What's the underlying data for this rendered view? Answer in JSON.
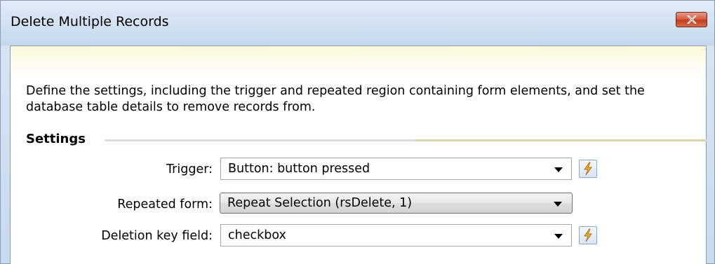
{
  "window": {
    "title": "Delete Multiple Records"
  },
  "description": "Define the settings, including the trigger and repeated region containing form elements, and set the database table details to remove records from.",
  "settings": {
    "section_title": "Settings",
    "fields": [
      {
        "label": "Trigger:",
        "value": "Button: button pressed",
        "has_bolt": true
      },
      {
        "label": "Repeated form:",
        "value": "Repeat Selection (rsDelete, 1)",
        "has_bolt": false
      },
      {
        "label": "Deletion key field:",
        "value": "checkbox",
        "has_bolt": true
      }
    ]
  },
  "icons": {
    "close": "close-icon",
    "dropdown": "chevron-down-icon",
    "dynamic_data": "lightning-bolt-icon"
  },
  "colors": {
    "close_button": "#c94a2c",
    "banner": "#fdf9d8",
    "bolt": "#e8a020"
  }
}
